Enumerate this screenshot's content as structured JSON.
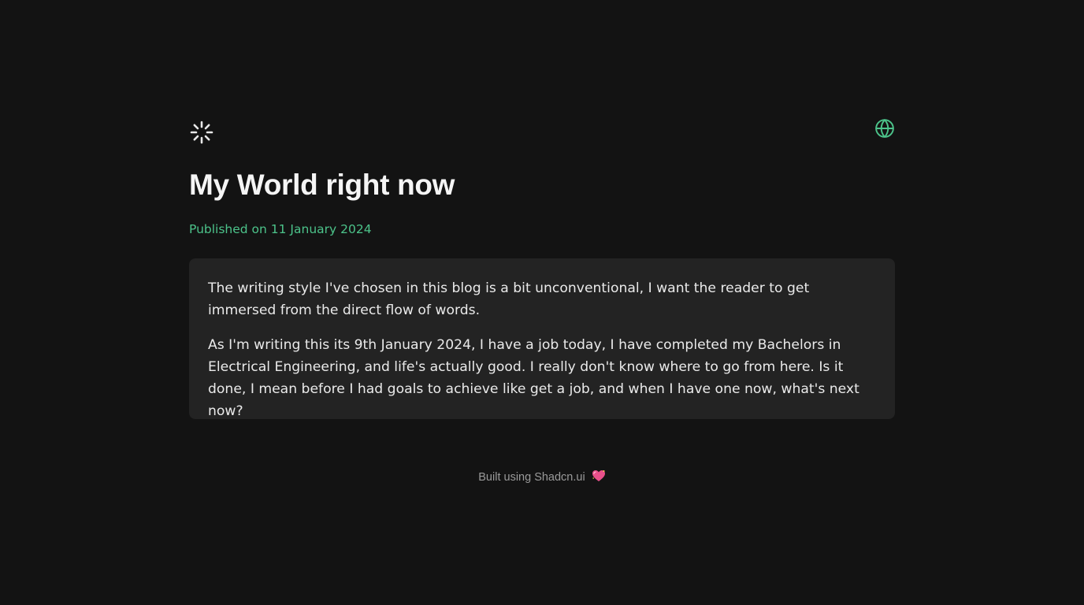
{
  "header": {
    "loader_icon": "loader-icon",
    "globe_icon": "globe-icon",
    "accent_color": "#4cc38a"
  },
  "post": {
    "title": "My World right now",
    "published": "Published on 11 January 2024",
    "paragraphs": [
      "The writing style I've chosen in this blog is a bit unconventional, I want the reader to get immersed from the direct flow of words.",
      "As I'm writing this its 9th January 2024, I have a job today, I have completed my Bachelors in Electrical Engineering, and life's actually good. I really don't know where to go from here. Is it done, I mean before I had goals to achieve like get a job, and when I have one now, what's next now?"
    ]
  },
  "footer": {
    "text": "Built using Shadcn.ui",
    "heart_icon": "sparkling-heart-icon"
  }
}
